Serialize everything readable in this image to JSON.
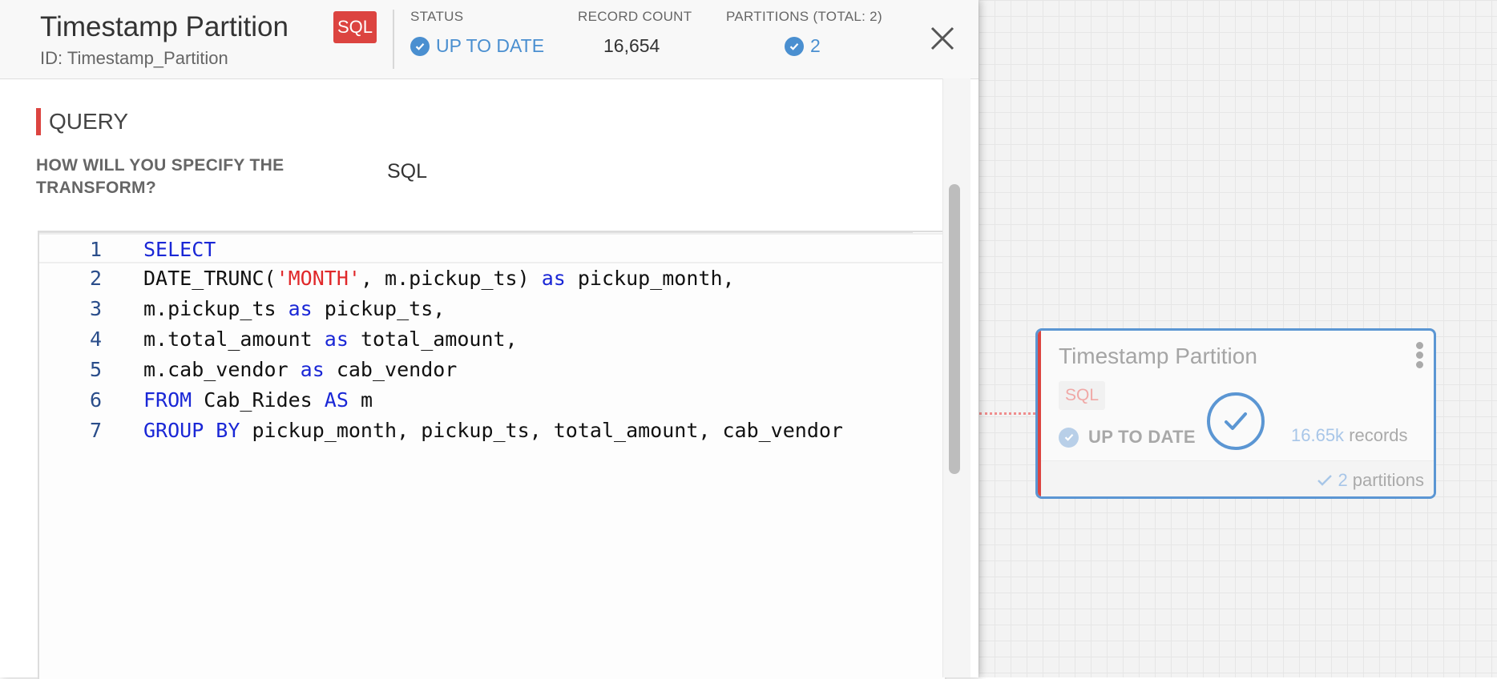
{
  "header": {
    "title": "Timestamp Partition",
    "badge": "SQL",
    "id_label": "ID: Timestamp_Partition",
    "status_label": "STATUS",
    "status_value": "UP TO DATE",
    "record_count_label": "RECORD COUNT",
    "record_count_value": "16,654",
    "partitions_label": "PARTITIONS (TOTAL: 2)",
    "partitions_value": "2"
  },
  "query": {
    "section_title": "QUERY",
    "field_label": "HOW WILL YOU SPECIFY THE TRANSFORM?",
    "field_value": "SQL",
    "lines": [
      {
        "n": "1",
        "tokens": [
          {
            "t": "SELECT",
            "c": "kw"
          }
        ]
      },
      {
        "n": "2",
        "tokens": [
          {
            "t": "DATE_TRUNC(",
            "c": ""
          },
          {
            "t": "'MONTH'",
            "c": "str"
          },
          {
            "t": ", m.pickup_ts) ",
            "c": ""
          },
          {
            "t": "as",
            "c": "kw"
          },
          {
            "t": " pickup_month,",
            "c": ""
          }
        ]
      },
      {
        "n": "3",
        "tokens": [
          {
            "t": "m.pickup_ts ",
            "c": ""
          },
          {
            "t": "as",
            "c": "kw"
          },
          {
            "t": " pickup_ts,",
            "c": ""
          }
        ]
      },
      {
        "n": "4",
        "tokens": [
          {
            "t": "m.total_amount ",
            "c": ""
          },
          {
            "t": "as",
            "c": "kw"
          },
          {
            "t": " total_amount,",
            "c": ""
          }
        ]
      },
      {
        "n": "5",
        "tokens": [
          {
            "t": "m.cab_vendor ",
            "c": ""
          },
          {
            "t": "as",
            "c": "kw"
          },
          {
            "t": " cab_vendor",
            "c": ""
          }
        ]
      },
      {
        "n": "6",
        "tokens": [
          {
            "t": "FROM",
            "c": "kw"
          },
          {
            "t": " Cab_Rides ",
            "c": ""
          },
          {
            "t": "AS",
            "c": "kw"
          },
          {
            "t": " m",
            "c": ""
          }
        ]
      },
      {
        "n": "7",
        "tokens": [
          {
            "t": "GROUP BY",
            "c": "kw"
          },
          {
            "t": " pickup_month, pickup_ts, total_amount, cab_vendor",
            "c": ""
          }
        ]
      }
    ]
  },
  "node": {
    "title": "Timestamp Partition",
    "badge": "SQL",
    "status": "UP TO DATE",
    "records_num": "16.65k",
    "records_label": "records",
    "partitions_num": "2",
    "partitions_label": "partitions"
  },
  "colors": {
    "accent_red": "#dc4440",
    "status_blue": "#4a8fd0",
    "keyword_blue": "#1a27d6",
    "string_red": "#e0282a"
  },
  "icons": [
    "check-circle-icon",
    "close-icon",
    "more-vertical-icon",
    "check-icon"
  ]
}
